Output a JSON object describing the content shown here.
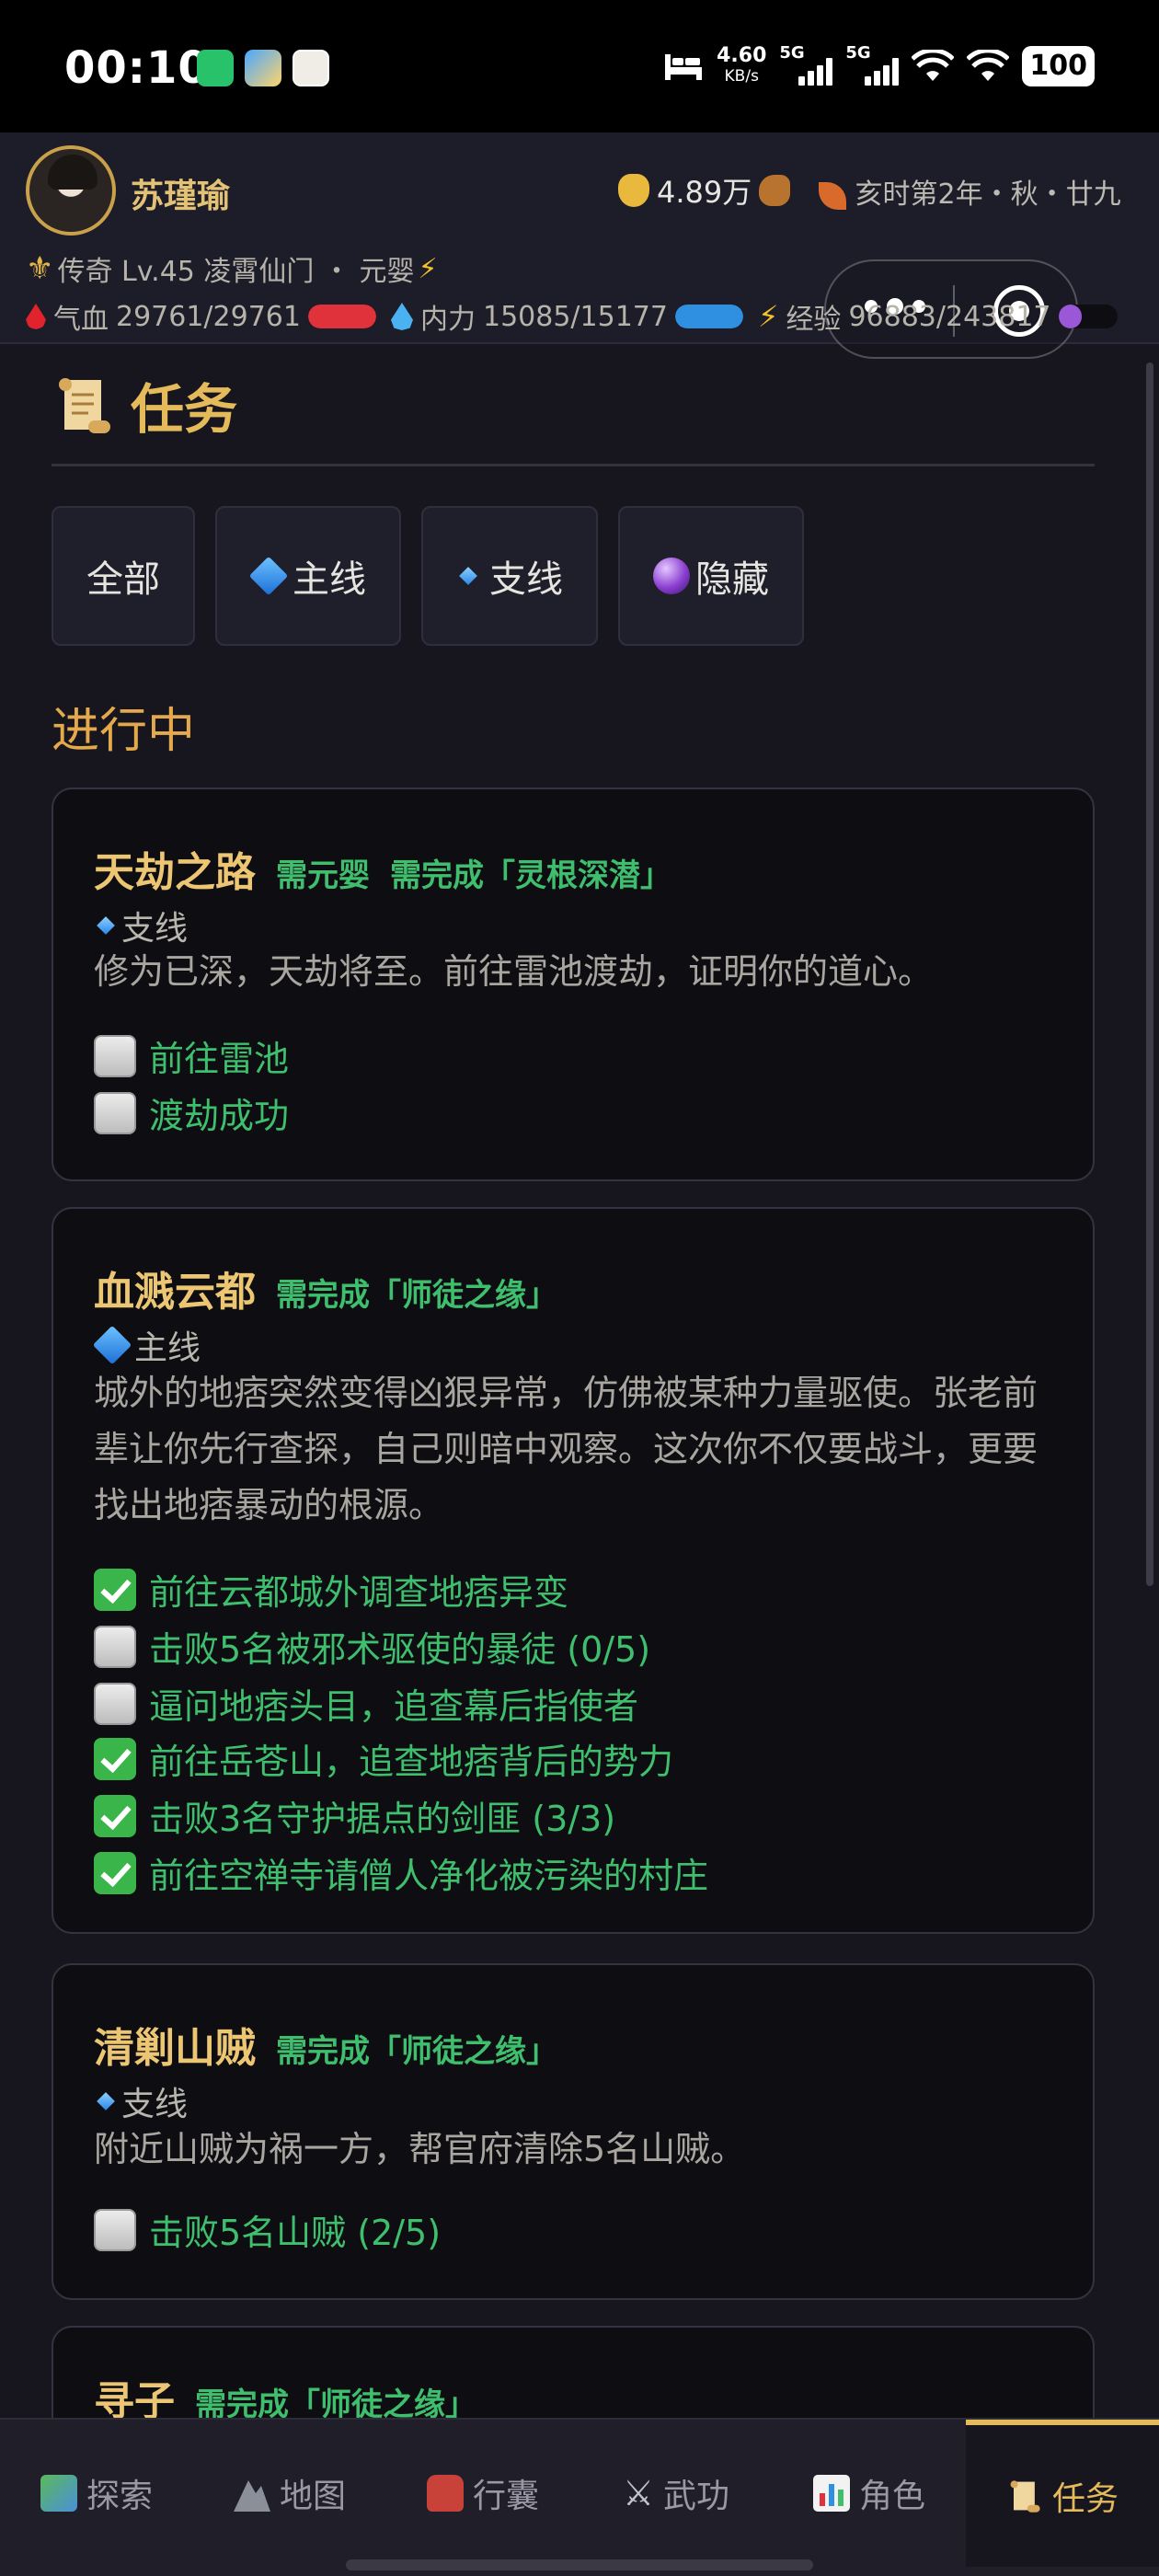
{
  "status_bar": {
    "time": "00:10",
    "net_speed": "4.60",
    "net_unit": "KB/s",
    "sim1": "5G",
    "sim2": "5G",
    "battery": "100"
  },
  "player": {
    "name": "苏瑾瑜",
    "gold": "4.89万",
    "time_info": "亥时第2年・秋・廿九",
    "rank_line": "传奇 Lv.45 凌霄仙门 ・ 元婴",
    "hp_label": "气血",
    "hp": "29761/29761",
    "hp_fraction": 1.0,
    "mp_label": "内力",
    "mp": "15085/15177",
    "mp_fraction": 0.994,
    "exp_label": "经验",
    "exp": "96883/243817",
    "exp_fraction": 0.397
  },
  "page": {
    "title": "任务",
    "filters": [
      {
        "label": "全部",
        "icon": "none"
      },
      {
        "label": "主线",
        "icon": "large-blue-diamond-icon"
      },
      {
        "label": "支线",
        "icon": "small-blue-diamond-icon"
      },
      {
        "label": "隐藏",
        "icon": "crystal-ball-icon"
      }
    ],
    "section": "进行中"
  },
  "quests": [
    {
      "name": "天劫之路",
      "reqs": [
        "需元婴",
        "需完成「灵根深潜」"
      ],
      "type": "支线",
      "desc": "修为已深，天劫将至。前往雷池渡劫，证明你的道心。",
      "objectives": [
        {
          "text": "前往雷池",
          "done": false
        },
        {
          "text": "渡劫成功",
          "done": false
        }
      ]
    },
    {
      "name": "血溅云都",
      "reqs": [
        "需完成「师徒之缘」"
      ],
      "type": "主线",
      "desc": "城外的地痞突然变得凶狠异常，仿佛被某种力量驱使。张老前辈让你先行查探，自己则暗中观察。这次你不仅要战斗，更要找出地痞暴动的根源。",
      "objectives": [
        {
          "text": "前往云都城外调查地痞异变",
          "done": true
        },
        {
          "text": "击败5名被邪术驱使的暴徒 (0/5)",
          "done": false
        },
        {
          "text": "逼问地痞头目，追查幕后指使者",
          "done": false
        },
        {
          "text": "前往岳苍山，追查地痞背后的势力",
          "done": true
        },
        {
          "text": "击败3名守护据点的剑匪 (3/3)",
          "done": true
        },
        {
          "text": "前往空禅寺请僧人净化被污染的村庄",
          "done": true
        }
      ]
    },
    {
      "name": "清剿山贼",
      "reqs": [
        "需完成「师徒之缘」"
      ],
      "type": "支线",
      "desc": "附近山贼为祸一方，帮官府清除5名山贼。",
      "objectives": [
        {
          "text": "击败5名山贼 (2/5)",
          "done": false
        }
      ]
    },
    {
      "name": "寻子",
      "reqs": [
        "需完成「师徒之缘」"
      ]
    }
  ],
  "nav": [
    {
      "label": "探索",
      "icon": "map-picture-icon"
    },
    {
      "label": "地图",
      "icon": "mountain-icon"
    },
    {
      "label": "行囊",
      "icon": "backpack-icon"
    },
    {
      "label": "武功",
      "icon": "crossed-swords-icon"
    },
    {
      "label": "角色",
      "icon": "bar-chart-icon"
    },
    {
      "label": "任务",
      "icon": "scroll-icon",
      "active": true
    }
  ],
  "colors": {
    "accent_gold": "#e4ba5a",
    "quest_green": "#3fbf6e",
    "hp_red": "#e0323a",
    "mp_blue": "#2f8fe0",
    "exp_purple": "#9a58d8"
  }
}
